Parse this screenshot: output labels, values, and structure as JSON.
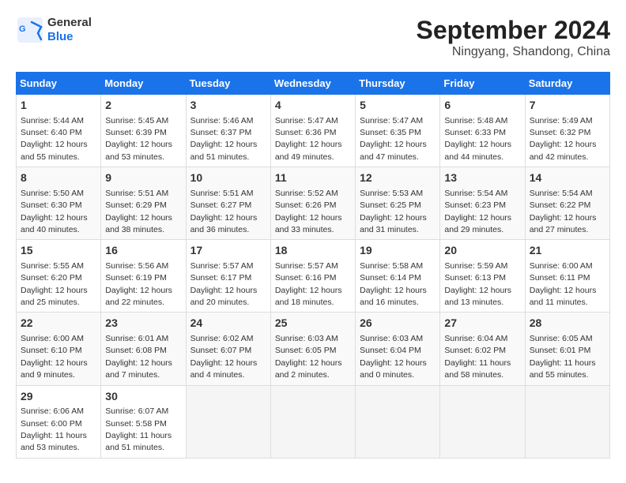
{
  "logo": {
    "text_general": "General",
    "text_blue": "Blue"
  },
  "header": {
    "month": "September 2024",
    "location": "Ningyang, Shandong, China"
  },
  "weekdays": [
    "Sunday",
    "Monday",
    "Tuesday",
    "Wednesday",
    "Thursday",
    "Friday",
    "Saturday"
  ],
  "weeks": [
    [
      {
        "day": "1",
        "sunrise": "5:44 AM",
        "sunset": "6:40 PM",
        "daylight": "12 hours and 55 minutes."
      },
      {
        "day": "2",
        "sunrise": "5:45 AM",
        "sunset": "6:39 PM",
        "daylight": "12 hours and 53 minutes."
      },
      {
        "day": "3",
        "sunrise": "5:46 AM",
        "sunset": "6:37 PM",
        "daylight": "12 hours and 51 minutes."
      },
      {
        "day": "4",
        "sunrise": "5:47 AM",
        "sunset": "6:36 PM",
        "daylight": "12 hours and 49 minutes."
      },
      {
        "day": "5",
        "sunrise": "5:47 AM",
        "sunset": "6:35 PM",
        "daylight": "12 hours and 47 minutes."
      },
      {
        "day": "6",
        "sunrise": "5:48 AM",
        "sunset": "6:33 PM",
        "daylight": "12 hours and 44 minutes."
      },
      {
        "day": "7",
        "sunrise": "5:49 AM",
        "sunset": "6:32 PM",
        "daylight": "12 hours and 42 minutes."
      }
    ],
    [
      {
        "day": "8",
        "sunrise": "5:50 AM",
        "sunset": "6:30 PM",
        "daylight": "12 hours and 40 minutes."
      },
      {
        "day": "9",
        "sunrise": "5:51 AM",
        "sunset": "6:29 PM",
        "daylight": "12 hours and 38 minutes."
      },
      {
        "day": "10",
        "sunrise": "5:51 AM",
        "sunset": "6:27 PM",
        "daylight": "12 hours and 36 minutes."
      },
      {
        "day": "11",
        "sunrise": "5:52 AM",
        "sunset": "6:26 PM",
        "daylight": "12 hours and 33 minutes."
      },
      {
        "day": "12",
        "sunrise": "5:53 AM",
        "sunset": "6:25 PM",
        "daylight": "12 hours and 31 minutes."
      },
      {
        "day": "13",
        "sunrise": "5:54 AM",
        "sunset": "6:23 PM",
        "daylight": "12 hours and 29 minutes."
      },
      {
        "day": "14",
        "sunrise": "5:54 AM",
        "sunset": "6:22 PM",
        "daylight": "12 hours and 27 minutes."
      }
    ],
    [
      {
        "day": "15",
        "sunrise": "5:55 AM",
        "sunset": "6:20 PM",
        "daylight": "12 hours and 25 minutes."
      },
      {
        "day": "16",
        "sunrise": "5:56 AM",
        "sunset": "6:19 PM",
        "daylight": "12 hours and 22 minutes."
      },
      {
        "day": "17",
        "sunrise": "5:57 AM",
        "sunset": "6:17 PM",
        "daylight": "12 hours and 20 minutes."
      },
      {
        "day": "18",
        "sunrise": "5:57 AM",
        "sunset": "6:16 PM",
        "daylight": "12 hours and 18 minutes."
      },
      {
        "day": "19",
        "sunrise": "5:58 AM",
        "sunset": "6:14 PM",
        "daylight": "12 hours and 16 minutes."
      },
      {
        "day": "20",
        "sunrise": "5:59 AM",
        "sunset": "6:13 PM",
        "daylight": "12 hours and 13 minutes."
      },
      {
        "day": "21",
        "sunrise": "6:00 AM",
        "sunset": "6:11 PM",
        "daylight": "12 hours and 11 minutes."
      }
    ],
    [
      {
        "day": "22",
        "sunrise": "6:00 AM",
        "sunset": "6:10 PM",
        "daylight": "12 hours and 9 minutes."
      },
      {
        "day": "23",
        "sunrise": "6:01 AM",
        "sunset": "6:08 PM",
        "daylight": "12 hours and 7 minutes."
      },
      {
        "day": "24",
        "sunrise": "6:02 AM",
        "sunset": "6:07 PM",
        "daylight": "12 hours and 4 minutes."
      },
      {
        "day": "25",
        "sunrise": "6:03 AM",
        "sunset": "6:05 PM",
        "daylight": "12 hours and 2 minutes."
      },
      {
        "day": "26",
        "sunrise": "6:03 AM",
        "sunset": "6:04 PM",
        "daylight": "12 hours and 0 minutes."
      },
      {
        "day": "27",
        "sunrise": "6:04 AM",
        "sunset": "6:02 PM",
        "daylight": "11 hours and 58 minutes."
      },
      {
        "day": "28",
        "sunrise": "6:05 AM",
        "sunset": "6:01 PM",
        "daylight": "11 hours and 55 minutes."
      }
    ],
    [
      {
        "day": "29",
        "sunrise": "6:06 AM",
        "sunset": "6:00 PM",
        "daylight": "11 hours and 53 minutes."
      },
      {
        "day": "30",
        "sunrise": "6:07 AM",
        "sunset": "5:58 PM",
        "daylight": "11 hours and 51 minutes."
      },
      null,
      null,
      null,
      null,
      null
    ]
  ]
}
